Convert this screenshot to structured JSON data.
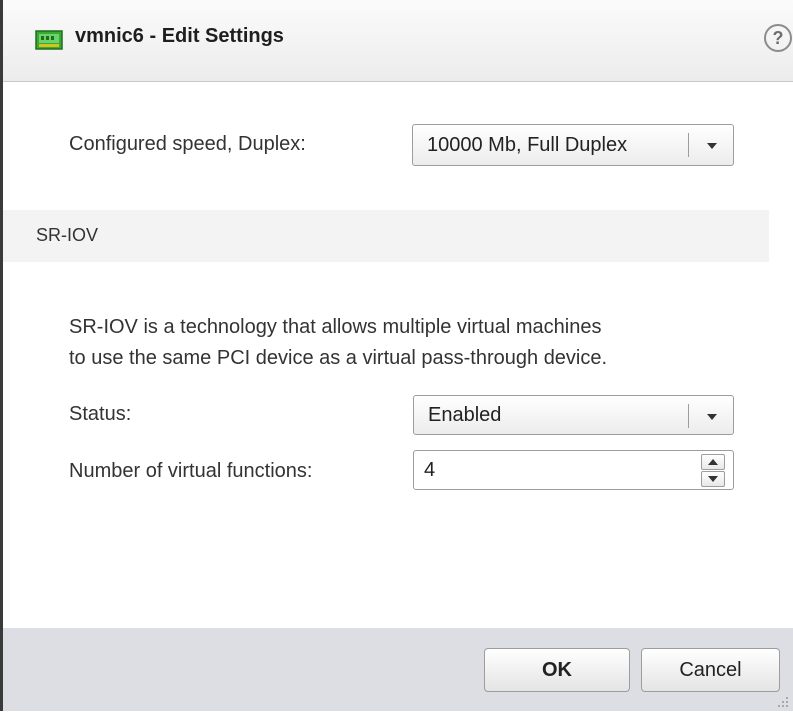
{
  "dialog": {
    "title": "vmnic6 - Edit Settings",
    "help_glyph": "?",
    "icon": "network-card-icon"
  },
  "speed": {
    "label": "Configured speed, Duplex:",
    "value": "10000 Mb, Full Duplex"
  },
  "sriov": {
    "section_title": "SR-IOV",
    "description_line1": "SR-IOV is a technology that allows multiple virtual machines",
    "description_line2": "to use the same PCI device as a virtual pass-through device.",
    "status_label": "Status:",
    "status_value": "Enabled",
    "vf_label": "Number of virtual functions:",
    "vf_value": "4"
  },
  "footer": {
    "ok_label": "OK",
    "cancel_label": "Cancel"
  },
  "colors": {
    "footer_bg": "#dcdee3",
    "section_bg": "#f3f3f3",
    "icon_green": "#3aa935"
  }
}
